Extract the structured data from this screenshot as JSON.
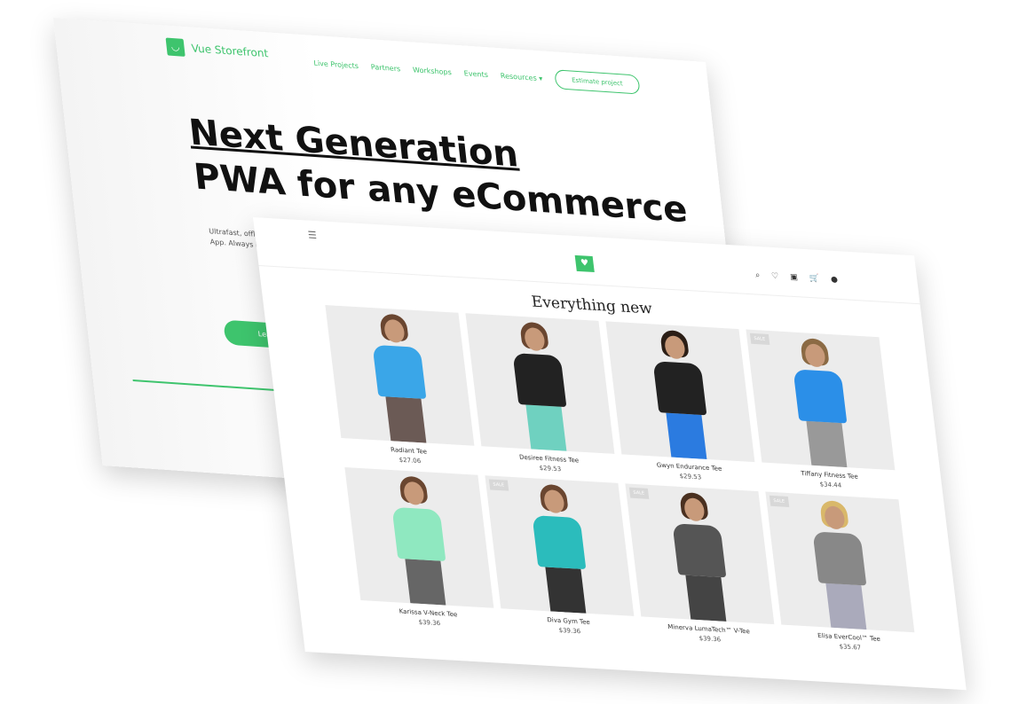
{
  "back": {
    "brand": "Vue Storefront",
    "nav": [
      "Live Projects",
      "Partners",
      "Workshops",
      "Events",
      "Resources ▾"
    ],
    "estimate": "Estimate project",
    "headline1": "Next Generation",
    "headline2": "PWA for any eCommerce",
    "sub1": "Ultrafast, offline",
    "sub2": "App. Always live",
    "learn": "Learn more",
    "accent": "#3ec46d"
  },
  "front": {
    "menu_icon": "☰",
    "logo_icon": "♥",
    "icons": [
      "⌕",
      "♡",
      "▣",
      "🛒",
      "●"
    ],
    "title": "Everything new",
    "products": [
      {
        "name": "Radiant Tee",
        "price": "$27.06",
        "sale": "",
        "shirt": "#3aa6e8",
        "pants": "#6b5a55",
        "hair": "#6a4630"
      },
      {
        "name": "Desiree Fitness Tee",
        "price": "$29.53",
        "sale": "",
        "shirt": "#222",
        "pants": "#6fd1c0",
        "hair": "#6a4630"
      },
      {
        "name": "Gwyn Endurance Tee",
        "price": "$29.53",
        "sale": "",
        "shirt": "#222",
        "pants": "#2b7be0",
        "hair": "#2b1e16"
      },
      {
        "name": "Tiffany Fitness Tee",
        "price": "$34.44",
        "sale": "SALE",
        "shirt": "#2b8fe8",
        "pants": "#999",
        "hair": "#8b6a44"
      },
      {
        "name": "Karissa V-Neck Tee",
        "price": "$39.36",
        "sale": "",
        "shirt": "#8fe8c0",
        "pants": "#666",
        "hair": "#6a4630"
      },
      {
        "name": "Diva Gym Tee",
        "price": "$39.36",
        "sale": "SALE",
        "shirt": "#2bbcbc",
        "pants": "#333",
        "hair": "#6a4630"
      },
      {
        "name": "Minerva LumaTech™ V-Tee",
        "price": "$39.36",
        "sale": "SALE",
        "shirt": "#555",
        "pants": "#444",
        "hair": "#4a3020"
      },
      {
        "name": "Elisa EverCool™ Tee",
        "price": "$35.67",
        "sale": "SALE",
        "shirt": "#888",
        "pants": "#aab",
        "hair": "#d9b86a"
      }
    ]
  }
}
